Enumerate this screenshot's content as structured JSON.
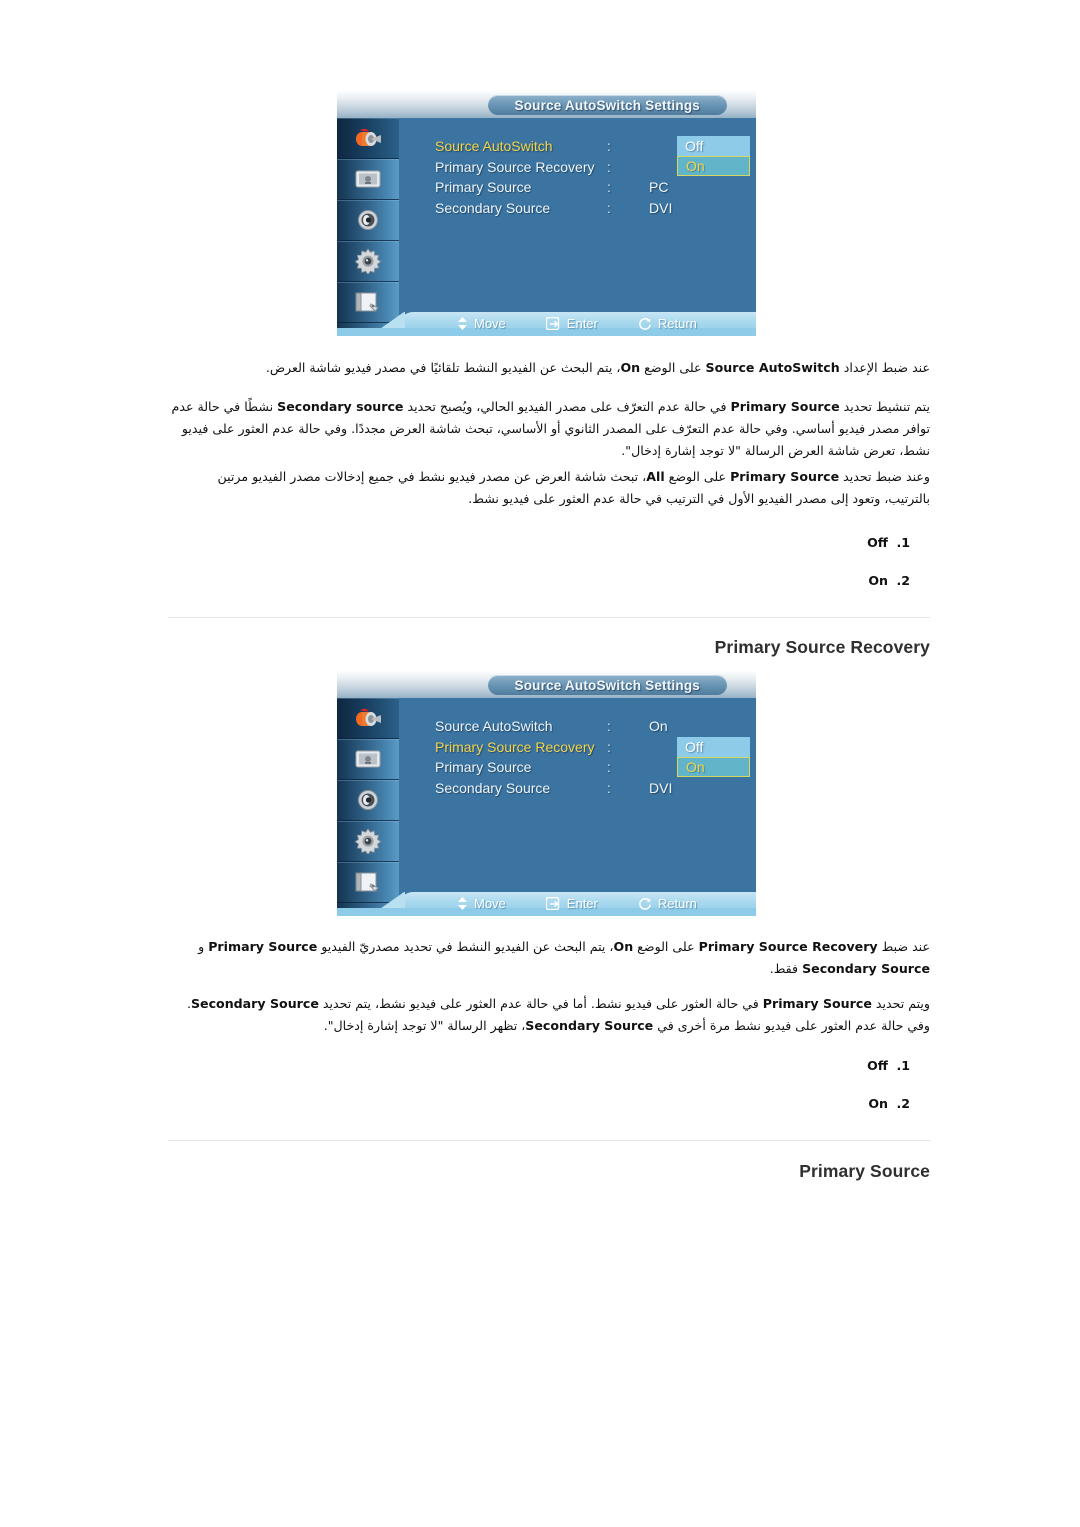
{
  "document": {
    "language": "ar",
    "direction": "rtl"
  },
  "osd_panels": [
    {
      "id": "osd-source-autoswitch",
      "title": "Source AutoSwitch Settings",
      "sidebar_icons": [
        "input-source-icon",
        "picture-icon",
        "sound-icon",
        "setup-gear-icon",
        "multi-control-icon"
      ],
      "active_sidebar_index": 0,
      "rows": [
        {
          "label": "Source AutoSwitch",
          "colon": ":",
          "value": "",
          "highlighted": true
        },
        {
          "label": "Primary Source Recovery",
          "colon": ":",
          "value": "",
          "highlighted": false
        },
        {
          "label": "Primary Source",
          "colon": ":",
          "value": "PC",
          "highlighted": false
        },
        {
          "label": "Secondary Source",
          "colon": ":",
          "value": "DVI",
          "highlighted": false
        }
      ],
      "options": [
        {
          "label": "Off",
          "state": "plain"
        },
        {
          "label": "On",
          "state": "selected"
        }
      ],
      "options_top_row": 0,
      "footer": [
        {
          "icon": "updown-arrow-icon",
          "label": "Move"
        },
        {
          "icon": "enter-icon",
          "label": "Enter"
        },
        {
          "icon": "return-icon",
          "label": "Return"
        }
      ]
    },
    {
      "id": "osd-primary-source-recovery",
      "title": "Source AutoSwitch Settings",
      "sidebar_icons": [
        "input-source-icon",
        "picture-icon",
        "sound-icon",
        "setup-gear-icon",
        "multi-control-icon"
      ],
      "active_sidebar_index": 0,
      "rows": [
        {
          "label": "Source AutoSwitch",
          "colon": ":",
          "value": "On",
          "highlighted": false
        },
        {
          "label": "Primary Source Recovery",
          "colon": ":",
          "value": "",
          "highlighted": true
        },
        {
          "label": "Primary Source",
          "colon": ":",
          "value": "",
          "highlighted": false
        },
        {
          "label": "Secondary Source",
          "colon": ":",
          "value": "DVI",
          "highlighted": false
        }
      ],
      "options": [
        {
          "label": "Off",
          "state": "plain"
        },
        {
          "label": "On",
          "state": "selected"
        }
      ],
      "options_top_row": 1,
      "footer": [
        {
          "icon": "updown-arrow-icon",
          "label": "Move"
        },
        {
          "icon": "enter-icon",
          "label": "Enter"
        },
        {
          "icon": "return-icon",
          "label": "Return"
        }
      ]
    }
  ],
  "sections": [
    {
      "id": "section-source-autoswitch",
      "paragraphs": [
        "عند ضبط الإعداد <b>Source AutoSwitch</b> على الوضع <b>On</b>، يتم البحث عن الفيديو النشط تلقائيًا في مصدر فيديو شاشة العرض.",
        "يتم تنشيط تحديد <b>Primary Source</b> في حالة عدم التعرّف على مصدر الفيديو الحالي، ويُصبح تحديد <b>Secondary source</b> نشطًا في حالة عدم توافر مصدر فيديو أساسي. وفي حالة عدم التعرّف على المصدر الثانوي أو الأساسي، تبحث شاشة العرض مجددًا. وفي حالة عدم العثور على فيديو نشط، تعرض شاشة العرض الرسالة \"لا توجد إشارة إدخال\".",
        "وعند ضبط تحديد <b>Primary Source</b> على الوضع <b>All</b>، تبحث شاشة العرض عن مصدر فيديو نشط في جميع إدخالات مصدر الفيديو مرتين بالترتيب، وتعود إلى مصدر الفيديو الأول في الترتيب في حالة عدم العثور على فيديو نشط."
      ],
      "options_list": [
        {
          "number": ".1",
          "label": "Off"
        },
        {
          "number": ".2",
          "label": "On"
        }
      ]
    },
    {
      "id": "section-primary-source-recovery",
      "heading": "Primary Source Recovery",
      "paragraphs": [
        "عند ضبط <b>Primary Source Recovery</b> على الوضع <b>On</b>، يتم البحث عن الفيديو النشط في تحديد مصدريّ الفيديو <b>Primary Source</b> و <b>Secondary Source</b> فقط.",
        "ويتم تحديد <b>Primary Source</b> في حالة العثور على فيديو نشط. أما في حالة عدم العثور على فيديو نشط، يتم تحديد <b>Secondary Source</b>. وفي حالة عدم العثور على فيديو نشط مرة أخرى في <b>Secondary Source</b>، تظهر الرسالة \"لا توجد إشارة إدخال\"."
      ],
      "options_list": [
        {
          "number": ".1",
          "label": "Off"
        },
        {
          "number": ".2",
          "label": "On"
        }
      ]
    },
    {
      "id": "section-primary-source",
      "heading": "Primary Source",
      "paragraphs": [],
      "options_list": []
    }
  ],
  "colors": {
    "osd_background": "#3b74a0",
    "osd_rail_dark": "#14344f",
    "osd_rail_light": "#5a9cc4",
    "option_plain_bg": "#8ecbe8",
    "option_selected_bg": "#62b5c9",
    "option_selected_border": "#d4d860",
    "highlight_text": "#f4d44a",
    "menu_text": "#eef5fb",
    "footer_bar": "#8ecbe8",
    "divider": "#e6e6e6",
    "heading_text": "#2f2f2f"
  }
}
